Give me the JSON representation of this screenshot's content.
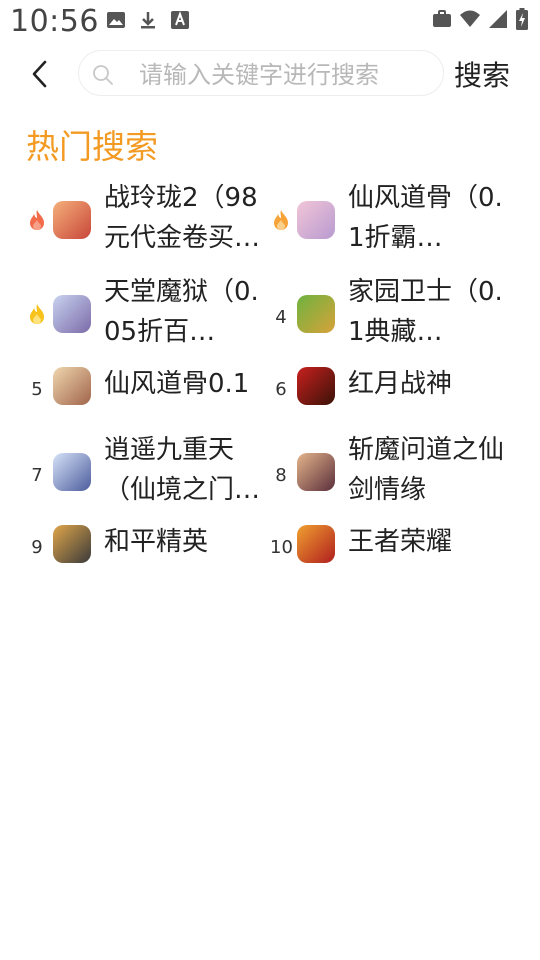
{
  "status_bar": {
    "time": "10:56",
    "left_icons": [
      "image-icon",
      "download-icon",
      "font-icon"
    ],
    "right_icons": [
      "briefcase-icon",
      "wifi-icon",
      "signal-icon",
      "battery-charging-icon"
    ]
  },
  "header": {
    "back_icon": "chevron-left-icon",
    "search_placeholder": "请输入关键字进行搜索",
    "search_value": "",
    "search_button": "搜索"
  },
  "hot": {
    "title": "热门搜索",
    "accent": "#f39a23",
    "items": [
      {
        "rank": "1",
        "rank_icon": "flame-red-icon",
        "name": "战玲珑2（98元代金卷买…",
        "thumb": "game-thumb-zhanlinglong",
        "colors": [
          "#f5b07a",
          "#c8463a"
        ]
      },
      {
        "rank": "2",
        "rank_icon": "flame-orange-icon",
        "name": "仙风道骨（0.1折霸…",
        "thumb": "game-thumb-xianfeng",
        "colors": [
          "#f2c6d8",
          "#b89ad0"
        ]
      },
      {
        "rank": "3",
        "rank_icon": "flame-yellow-icon",
        "name": "天堂魔狱（0.05折百…",
        "thumb": "game-thumb-tiantang",
        "colors": [
          "#c9d3f0",
          "#7b6aa8"
        ]
      },
      {
        "rank": "4",
        "rank_icon": "",
        "name": "家园卫士（0.1典藏…",
        "thumb": "game-thumb-jiayuan",
        "colors": [
          "#6db33f",
          "#d8a23a"
        ]
      },
      {
        "rank": "5",
        "rank_icon": "",
        "name": "仙风道骨0.1",
        "thumb": "game-thumb-xianfeng01",
        "colors": [
          "#f0d7b0",
          "#a0644a"
        ]
      },
      {
        "rank": "6",
        "rank_icon": "",
        "name": "红月战神",
        "thumb": "game-thumb-hongyue",
        "colors": [
          "#c8201e",
          "#3a1208"
        ]
      },
      {
        "rank": "7",
        "rank_icon": "",
        "name": "逍遥九重天（仙境之门…",
        "thumb": "game-thumb-xiaoyao",
        "colors": [
          "#d6e2f8",
          "#4c5c9c"
        ]
      },
      {
        "rank": "8",
        "rank_icon": "",
        "name": "斩魔问道之仙剑情缘",
        "thumb": "game-thumb-zhanmo",
        "colors": [
          "#e5b58a",
          "#5a2e3c"
        ]
      },
      {
        "rank": "9",
        "rank_icon": "",
        "name": "和平精英",
        "thumb": "game-thumb-heping",
        "colors": [
          "#e0a64a",
          "#3a3a3a"
        ]
      },
      {
        "rank": "10",
        "rank_icon": "",
        "name": "王者荣耀",
        "thumb": "game-thumb-wangzhe",
        "colors": [
          "#f0a030",
          "#b01e1e"
        ]
      }
    ]
  }
}
